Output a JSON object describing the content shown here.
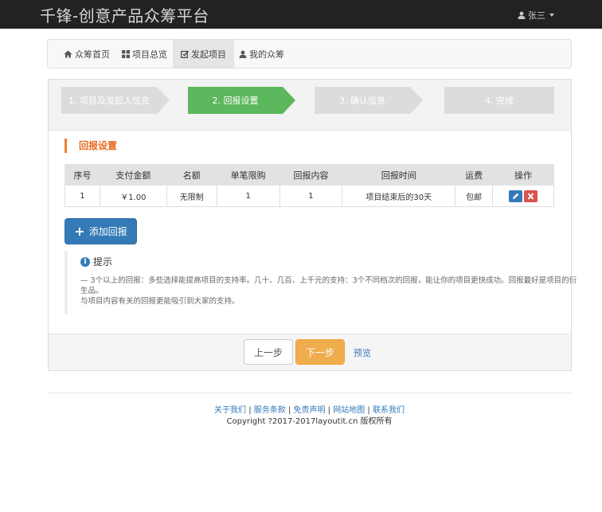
{
  "navbar": {
    "brand": "千锋-创意产品众筹平台",
    "user": "张三"
  },
  "subnav": {
    "items": [
      {
        "label": "众筹首页",
        "icon": "home-icon"
      },
      {
        "label": "项目总览",
        "icon": "grid-icon"
      },
      {
        "label": "发起项目",
        "icon": "edit-icon"
      },
      {
        "label": "我的众筹",
        "icon": "user-icon"
      }
    ],
    "active": "发起项目"
  },
  "steps": [
    "1. 项目及发起人信息",
    "2. 回报设置",
    "3. 确认信息",
    "4. 完成"
  ],
  "colors": {
    "step_active": "#5cb85c",
    "step_inactive": "#dcdcdc",
    "accent": "#e8691e",
    "primary": "#337ab7",
    "danger": "#d9534f",
    "warning": "#f0ad4e"
  },
  "section": {
    "title": "回报设置"
  },
  "table": {
    "headers": [
      "序号",
      "支付金额",
      "名额",
      "单笔限购",
      "回报内容",
      "回报时间",
      "运费",
      "操作"
    ],
    "rows": [
      [
        "1",
        "￥1.00",
        "无限制",
        "1",
        "1",
        "项目结束后的30天",
        "包邮"
      ]
    ]
  },
  "add_button": "添加回报",
  "tip": {
    "title": "提示",
    "line1": "— 3个以上的回报：多些选择能提高项目的支持率。几十、几百、上千元的支持：3个不同档次的回报，能让你的项目更快成功。回报最好是项目的衍生品。",
    "line2": "与项目内容有关的回报更能吸引到大家的支持。"
  },
  "actions": {
    "prev": "上一步",
    "next": "下一步",
    "preview": "预览"
  },
  "footer": {
    "links": [
      "关于我们",
      "服务条款",
      "免责声明",
      "网站地图",
      "联系我们"
    ],
    "copyright": "Copyright ?2017-2017layoutit.cn 版权所有"
  }
}
